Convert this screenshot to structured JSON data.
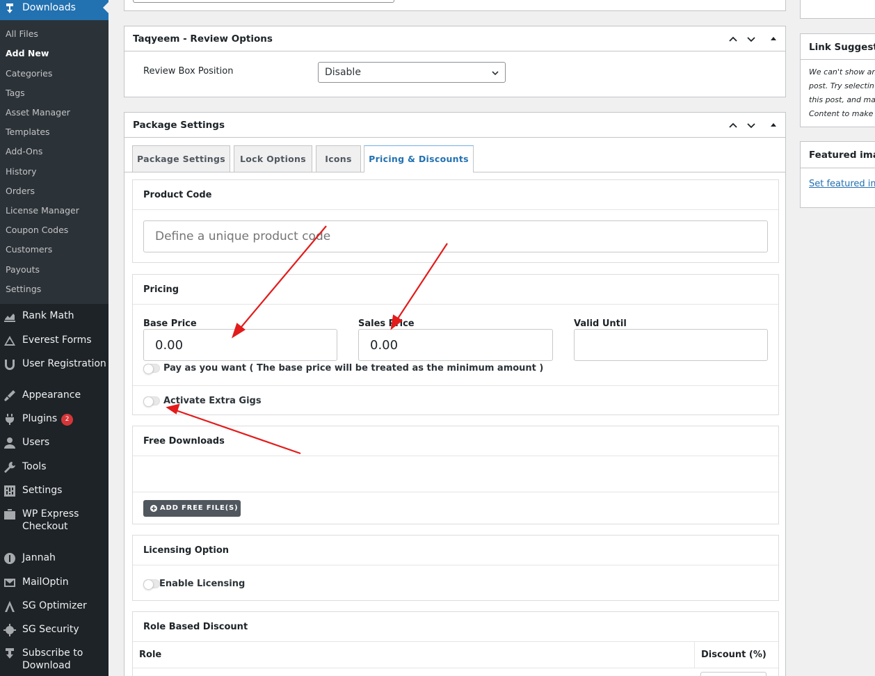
{
  "sidebar": {
    "current": "Downloads",
    "submenu": [
      "All Files",
      "Add New",
      "Categories",
      "Tags",
      "Asset Manager",
      "Templates",
      "Add-Ons",
      "History",
      "Orders",
      "License Manager",
      "Coupon Codes",
      "Customers",
      "Payouts",
      "Settings"
    ],
    "active_submenu": "Add New",
    "menu": [
      {
        "label": "Rank Math",
        "icon": "rank-math-icon"
      },
      {
        "label": "Everest Forms",
        "icon": "everest-forms-icon"
      },
      {
        "label": "User Registration",
        "icon": "user-registration-icon"
      },
      {
        "label": "Appearance",
        "icon": "appearance-icon"
      },
      {
        "label": "Plugins",
        "icon": "plugins-icon",
        "badge": "2"
      },
      {
        "label": "Users",
        "icon": "users-icon"
      },
      {
        "label": "Tools",
        "icon": "tools-icon"
      },
      {
        "label": "Settings",
        "icon": "settings-icon"
      },
      {
        "label": "WP Express",
        "label2": "Checkout",
        "icon": "wp-express-checkout-icon"
      },
      {
        "label": "Jannah",
        "icon": "jannah-icon"
      },
      {
        "label": "MailOptin",
        "icon": "mailoptin-icon"
      },
      {
        "label": "SG Optimizer",
        "icon": "sg-optimizer-icon"
      },
      {
        "label": "SG Security",
        "icon": "sg-security-icon"
      },
      {
        "label": "Subscribe to",
        "label2": "Download",
        "icon": "subscribe-download-icon"
      }
    ]
  },
  "review": {
    "title": "Taqyeem - Review Options",
    "position_label": "Review Box Position",
    "position_value": "Disable"
  },
  "package": {
    "title": "Package Settings",
    "tabs": [
      "Package Settings",
      "Lock Options",
      "Icons",
      "Pricing & Discounts"
    ],
    "active_tab": "Pricing & Discounts",
    "product_code": {
      "title": "Product Code",
      "placeholder": "Define a unique product code"
    },
    "pricing": {
      "title": "Pricing",
      "base_label": "Base Price",
      "base_value": "0.00",
      "sales_label": "Sales Price",
      "sales_value": "0.00",
      "valid_label": "Valid Until",
      "valid_value": "",
      "pay_as_you_want": "Pay as you want ( The base price will be treated as the minimum amount )",
      "extra_gigs": "Activate Extra Gigs"
    },
    "free_downloads": {
      "title": "Free Downloads",
      "button": "ADD FREE FILE(S)"
    },
    "licensing": {
      "title": "Licensing Option",
      "toggle": "Enable Licensing"
    },
    "role_discount": {
      "title": "Role Based Discount",
      "col_role": "Role",
      "col_discount": "Discount (%)"
    }
  },
  "right": {
    "link_title": "Link Suggestio",
    "link_text": [
      "We can't show an",
      "post. Try selectin",
      "this post, and ma",
      "Content to make"
    ],
    "featured_title": "Featured imag",
    "featured_link": "Set featured ima"
  },
  "colors": {
    "accent": "#2271b1",
    "sidebar": "#1d2327",
    "submenu": "#2c3338",
    "annotation": "#e31b1b"
  }
}
